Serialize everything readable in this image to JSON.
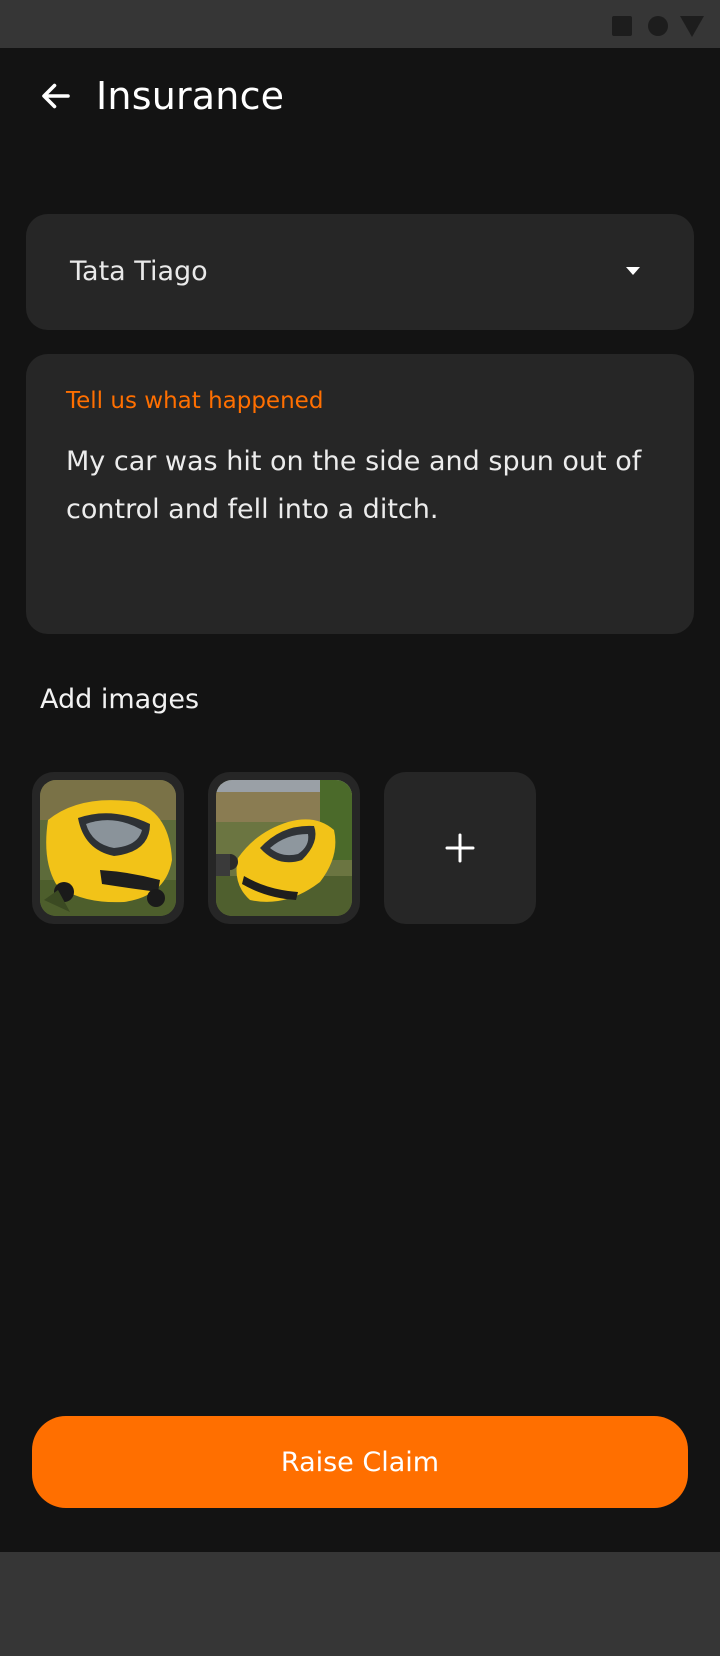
{
  "app_bar": {
    "title": "Insurance",
    "back_icon": "arrow-left-icon"
  },
  "vehicle_select": {
    "value": "Tata Tiago",
    "icon": "caret-down-icon"
  },
  "incident": {
    "label": "Tell us what happened",
    "value": "My car was hit on the side and spun out of control and fell into a ditch."
  },
  "images_section": {
    "title": "Add images",
    "add_icon": "plus-icon"
  },
  "actions": {
    "submit_label": "Raise Claim"
  },
  "colors": {
    "background": "#131313",
    "surface": "#262626",
    "accent": "#ff6f00",
    "system_bars": "#363636"
  }
}
